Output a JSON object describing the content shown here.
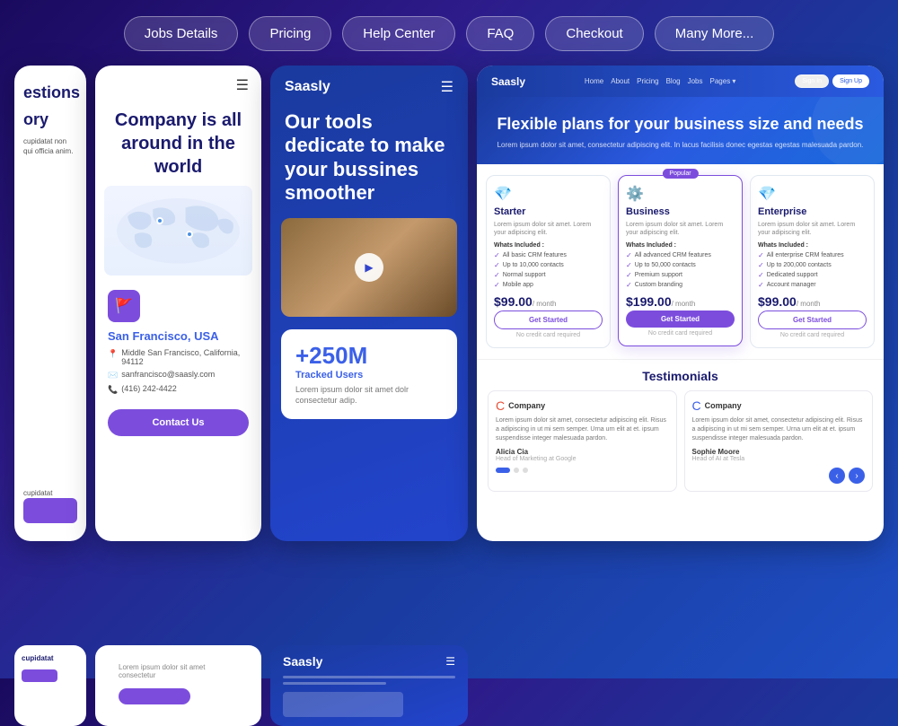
{
  "nav": {
    "pills": [
      {
        "id": "jobs-details",
        "label": "Jobs Details"
      },
      {
        "id": "pricing",
        "label": "Pricing"
      },
      {
        "id": "help-center",
        "label": "Help Center"
      },
      {
        "id": "faq",
        "label": "FAQ"
      },
      {
        "id": "checkout",
        "label": "Checkout"
      },
      {
        "id": "many-more",
        "label": "Many More..."
      }
    ]
  },
  "card_left": {
    "title1": "estions",
    "title2": "ory",
    "text": "cupidatat non qui officia anim.",
    "bottom_text": "cupidatat"
  },
  "card_company": {
    "title": "Company is all around in the world",
    "location_name": "San Francisco, USA",
    "address": "Middle San Francisco, California, 94112",
    "email": "sanfrancisco@saasly.com",
    "phone": "(416) 242-4422",
    "contact_btn": "Contact Us"
  },
  "card_saasly": {
    "logo": "Saasly",
    "hero_text": "Our tools dedicate to make your bussines smoother",
    "stats_number": "+250M",
    "stats_label": "Tracked Users",
    "stats_desc": "Lorem ipsum dolor sit amet dolr consectetur adip."
  },
  "card_pricing": {
    "nav_logo": "Saasly",
    "nav_links": [
      "Home",
      "About",
      "Pricing",
      "Blog",
      "Jobs",
      "Pages"
    ],
    "nav_sign_in": "Sign In",
    "nav_sign_up": "Sign Up",
    "hero_title": "Flexible plans for your business size and needs",
    "hero_sub": "Lorem ipsum dolor sit amet, consectetur adipiscing elit. In lacus facilisis donec egestas egestas malesuada pardon.",
    "tiers": [
      {
        "id": "starter",
        "icon": "💎",
        "name": "Starter",
        "desc": "Lorem ipsum dolor sit amet. Lorem your adipiscing elit.",
        "whats_included": "Whats Included :",
        "features": [
          "All basic CRM features",
          "Up to 10,000 contacts",
          "Normal support",
          "Mobile app"
        ],
        "price": "$99.00",
        "period": "/ month",
        "btn_label": "Get Started",
        "btn_type": "outline",
        "no_card": "No credit card required",
        "popular": false
      },
      {
        "id": "business",
        "icon": "⚙️",
        "name": "Business",
        "desc": "Lorem ipsum dolor sit amet. Lorem your adipiscing elit.",
        "whats_included": "Whats Included :",
        "features": [
          "All advanced CRM features",
          "Up to 50,000 contacts",
          "Premium support",
          "Custom branding"
        ],
        "price": "$199.00",
        "period": "/ month",
        "btn_label": "Get Started",
        "btn_type": "filled",
        "no_card": "No credit card required",
        "popular": true,
        "popular_label": "Popular"
      },
      {
        "id": "enterprise",
        "icon": "💎",
        "name": "Enterprise",
        "desc": "Lorem ipsum dolor sit amet. Lorem your adipiscing elit.",
        "whats_included": "Whats Included :",
        "features": [
          "All enterprise CRM features",
          "Up to 200,000 contacts",
          "Dedicated support",
          "Account manager"
        ],
        "price": "$99.00",
        "period": "/ month",
        "btn_label": "Get Started",
        "btn_type": "outline",
        "no_card": "No credit card required",
        "popular": false
      }
    ],
    "testimonials_title": "Testimonials",
    "testimonials": [
      {
        "company": "Company",
        "company_color": "#e8523a",
        "text": "Lorem ipsum dolor sit amet, consectetur adipiscing elit. Risus a adipiscing in ut mi sem semper. Urna urn elit at et. ipsum suspendisse integer malesuada pardon.",
        "author": "Alicia Cia",
        "role": "Head of Marketing at Google"
      },
      {
        "company": "Company",
        "company_color": "#3b60e8",
        "text": "Lorem ipsum dolor sit amet, consectetur adipiscing elit. Risus a adipiscing in ut mi sem semper. Urna urn elit at et. ipsum suspendisse integer malesuada pardon.",
        "author": "Sophie Moore",
        "role": "Head of AI at Tesla"
      }
    ],
    "dots": 3,
    "active_dot": 0
  },
  "bottom": {
    "saasly_logo": "Saasly"
  }
}
